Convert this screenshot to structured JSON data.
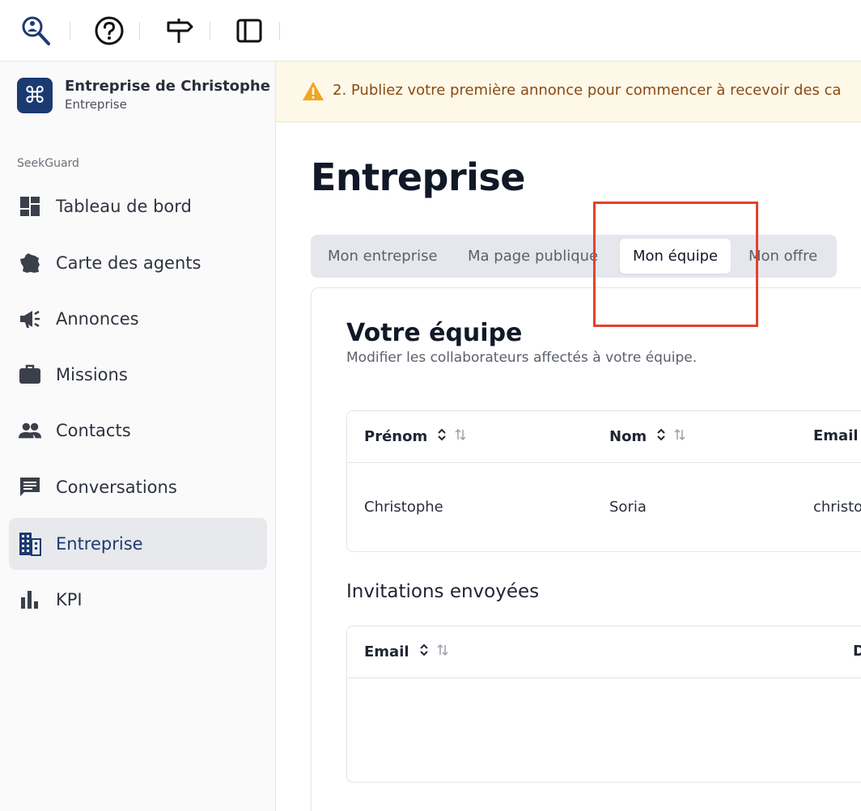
{
  "toolbar": {
    "icons": [
      "seekguard-logo-icon",
      "help-icon",
      "signpost-icon",
      "sidebar-toggle-icon"
    ]
  },
  "sidebar": {
    "company_name": "Entreprise de Christophe",
    "company_type": "Entreprise",
    "section_label": "SeekGuard",
    "items": [
      {
        "label": "Tableau de bord",
        "icon": "dashboard-icon"
      },
      {
        "label": "Carte des agents",
        "icon": "france-map-icon"
      },
      {
        "label": "Annonces",
        "icon": "megaphone-icon"
      },
      {
        "label": "Missions",
        "icon": "briefcase-icon"
      },
      {
        "label": "Contacts",
        "icon": "people-icon"
      },
      {
        "label": "Conversations",
        "icon": "chat-icon"
      },
      {
        "label": "Entreprise",
        "icon": "building-icon",
        "active": true
      },
      {
        "label": "KPI",
        "icon": "bar-chart-icon"
      }
    ]
  },
  "banner": {
    "text": "2. Publiez votre première annonce pour commencer à recevoir des ca"
  },
  "main": {
    "page_title": "Entreprise",
    "tabs": [
      {
        "label": "Mon entreprise"
      },
      {
        "label": "Ma page publique"
      },
      {
        "label": "Mon équipe",
        "active": true
      },
      {
        "label": "Mon offre"
      }
    ],
    "team": {
      "title": "Votre équipe",
      "subtitle": "Modifier les collaborateurs affectés à votre équipe.",
      "columns": [
        "Prénom",
        "Nom",
        "Email"
      ],
      "rows": [
        {
          "first_name": "Christophe",
          "last_name": "Soria",
          "email": "christo"
        }
      ]
    },
    "invitations": {
      "title": "Invitations envoyées",
      "columns": [
        "Email",
        "D"
      ]
    }
  },
  "colors": {
    "brand": "#1c3a72",
    "highlight": "#e1432b",
    "banner_bg": "#fdf8e7",
    "banner_text": "#8a4a14"
  }
}
